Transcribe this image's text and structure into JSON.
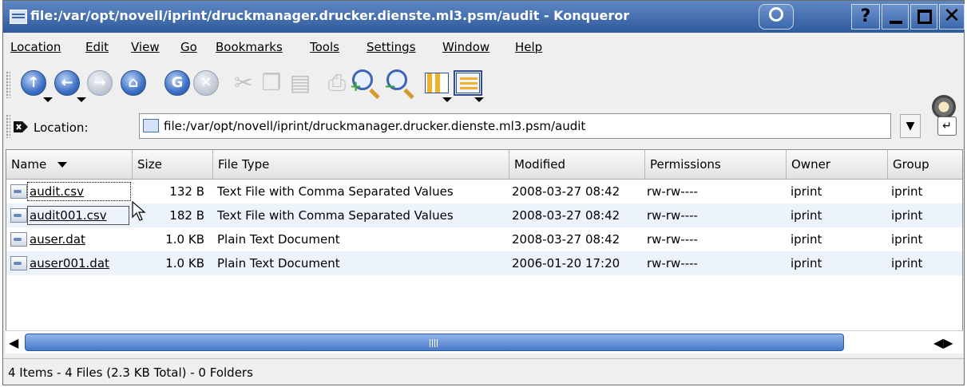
{
  "window": {
    "title": "file:/var/opt/novell/iprint/druckmanager.drucker.dienste.ml3.psm/audit - Konqueror",
    "help_label": "?",
    "close_label": "✕"
  },
  "menubar": [
    "Location",
    "Edit",
    "View",
    "Go",
    "Bookmarks",
    "Tools",
    "Settings",
    "Window",
    "Help"
  ],
  "toolbar": {
    "icons": [
      "up-icon",
      "back-icon",
      "forward-icon",
      "home-icon",
      "reload-icon",
      "stop-icon",
      "cut-icon",
      "copy-icon",
      "paste-icon",
      "print-icon",
      "zoom-in-icon",
      "zoom-out-icon",
      "icon-view-icon",
      "detailed-list-view-icon",
      "konqueror-gear-icon"
    ]
  },
  "location": {
    "label": "Location:",
    "value": "file:/var/opt/novell/iprint/druckmanager.drucker.dienste.ml3.psm/audit"
  },
  "columns": [
    "Name",
    "Size",
    "File Type",
    "Modified",
    "Permissions",
    "Owner",
    "Group"
  ],
  "files": [
    {
      "name": "audit.csv",
      "size": "132 B",
      "type": "Text File with Comma Separated Values",
      "modified": "2008-03-27 08:42",
      "permissions": "rw-rw----",
      "owner": "iprint",
      "group": "iprint"
    },
    {
      "name": "audit001.csv",
      "size": "182 B",
      "type": "Text File with Comma Separated Values",
      "modified": "2008-03-27 08:42",
      "permissions": "rw-rw----",
      "owner": "iprint",
      "group": "iprint"
    },
    {
      "name": "auser.dat",
      "size": "1.0 KB",
      "type": "Plain Text Document",
      "modified": "2008-03-27 08:42",
      "permissions": "rw-rw----",
      "owner": "iprint",
      "group": "iprint"
    },
    {
      "name": "auser001.dat",
      "size": "1.0 KB",
      "type": "Plain Text Document",
      "modified": "2006-01-20 17:20",
      "permissions": "rw-rw----",
      "owner": "iprint",
      "group": "iprint"
    }
  ],
  "status": "4 Items - 4 Files (2.3 KB Total) - 0 Folders",
  "colors": {
    "titlebar": "#3a67ad",
    "row_alt": "#edf3fd",
    "scrollbar": "#4a7bc9"
  }
}
